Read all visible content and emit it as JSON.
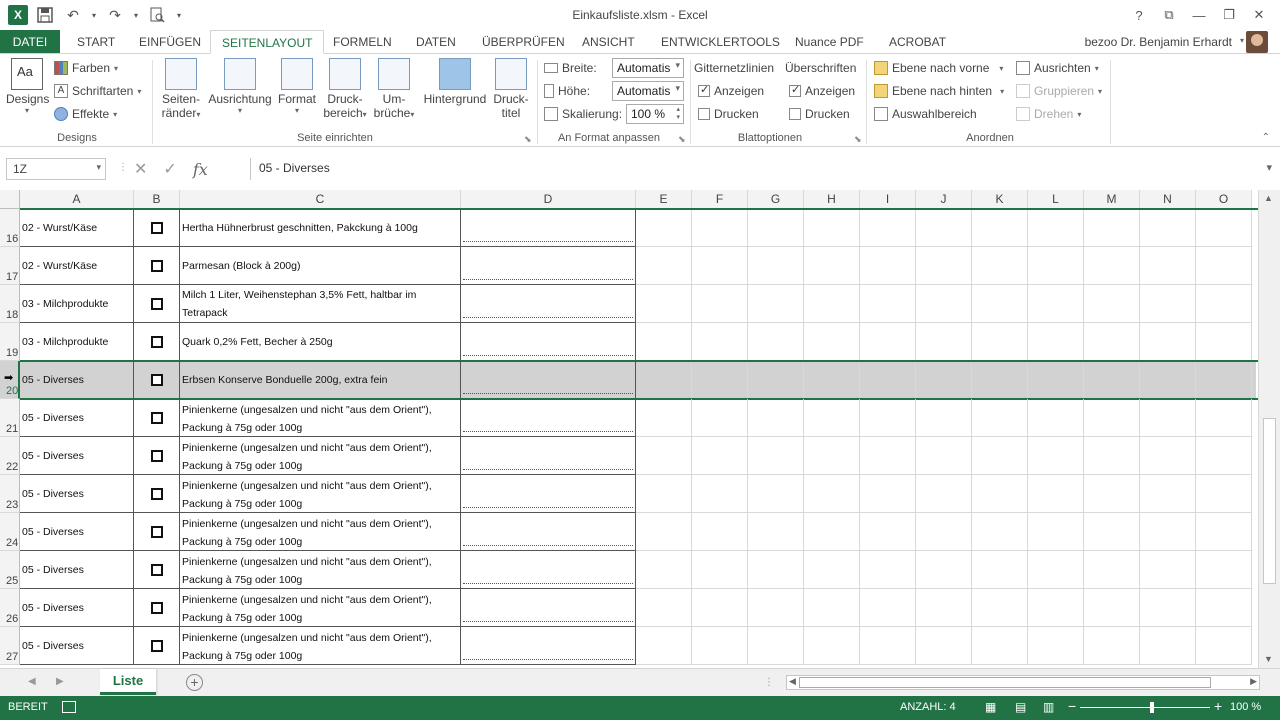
{
  "window": {
    "title": "Einkaufsliste.xlsm - Excel",
    "user": "bezoo Dr. Benjamin Erhardt",
    "help": "?",
    "ribbon_opts": "⧉",
    "minimize": "—",
    "restore": "❐",
    "close": "✕"
  },
  "qat": {
    "logo": "X"
  },
  "tabs": [
    {
      "label": "DATEI"
    },
    {
      "label": "START"
    },
    {
      "label": "EINFÜGEN"
    },
    {
      "label": "SEITENLAYOUT"
    },
    {
      "label": "FORMELN"
    },
    {
      "label": "DATEN"
    },
    {
      "label": "ÜBERPRÜFEN"
    },
    {
      "label": "ANSICHT"
    },
    {
      "label": "ENTWICKLERTOOLS"
    },
    {
      "label": "Nuance PDF"
    },
    {
      "label": "ACROBAT"
    }
  ],
  "ribbon": {
    "designs": {
      "label": "Designs",
      "farben": "Farben",
      "schriftarten": "Schriftarten",
      "effekte": "Effekte",
      "group": "Designs"
    },
    "seite": {
      "seitenraender": [
        "Seiten-",
        "ränder"
      ],
      "ausrichtung": "Ausrichtung",
      "format": "Format",
      "druckbereich": [
        "Druck-",
        "bereich"
      ],
      "umbrueche": [
        "Um-",
        "brüche"
      ],
      "hintergrund": "Hintergrund",
      "drucktitel": [
        "Druck-",
        "titel"
      ],
      "group": "Seite einrichten"
    },
    "anpassen": {
      "breite_label": "Breite:",
      "breite_value": "Automatis",
      "hoehe_label": "Höhe:",
      "hoehe_value": "Automatis",
      "skalierung_label": "Skalierung:",
      "skalierung_value": "100 %",
      "group": "An Format anpassen"
    },
    "blatt": {
      "gitternetz": "Gitternetzlinien",
      "ueberschriften": "Überschriften",
      "anzeigen": "Anzeigen",
      "drucken": "Drucken",
      "group": "Blattoptionen"
    },
    "anordnen": {
      "vorne": "Ebene nach vorne",
      "hinten": "Ebene nach hinten",
      "auswahl": "Auswahlbereich",
      "ausrichten": "Ausrichten",
      "gruppieren": "Gruppieren",
      "drehen": "Drehen",
      "group": "Anordnen"
    }
  },
  "formula_bar": {
    "namebox": "1Z",
    "content": "05 - Diverses",
    "fx": "fx"
  },
  "columns": [
    "A",
    "B",
    "C",
    "D",
    "E",
    "F",
    "G",
    "H",
    "I",
    "J",
    "K",
    "L",
    "M",
    "N",
    "O"
  ],
  "rows": [
    {
      "num": "16",
      "a": "02 - Wurst/Käse",
      "c": "Hertha Hühnerbrust geschnitten, Pakckung à 100g"
    },
    {
      "num": "17",
      "a": "02 - Wurst/Käse",
      "c": "Parmesan (Block à 200g)"
    },
    {
      "num": "18",
      "a": "03 - Milchprodukte",
      "c": "Milch 1 Liter, Weihenstephan 3,5% Fett, haltbar im Tetrapack"
    },
    {
      "num": "19",
      "a": "03 - Milchprodukte",
      "c": "Quark 0,2% Fett, Becher à 250g"
    },
    {
      "num": "20",
      "a": "05 - Diverses",
      "c": "Erbsen Konserve Bonduelle 200g, extra fein"
    },
    {
      "num": "21",
      "a": "05 - Diverses",
      "c": "Pinienkerne (ungesalzen und nicht \"aus dem Orient\"), Packung à 75g oder 100g"
    },
    {
      "num": "22",
      "a": "05 - Diverses",
      "c": "Pinienkerne (ungesalzen und nicht \"aus dem Orient\"), Packung à 75g oder 100g"
    },
    {
      "num": "23",
      "a": "05 - Diverses",
      "c": "Pinienkerne (ungesalzen und nicht \"aus dem Orient\"), Packung à 75g oder 100g"
    },
    {
      "num": "24",
      "a": "05 - Diverses",
      "c": "Pinienkerne (ungesalzen und nicht \"aus dem Orient\"), Packung à 75g oder 100g"
    },
    {
      "num": "25",
      "a": "05 - Diverses",
      "c": "Pinienkerne (ungesalzen und nicht \"aus dem Orient\"), Packung à 75g oder 100g"
    },
    {
      "num": "26",
      "a": "05 - Diverses",
      "c": "Pinienkerne (ungesalzen und nicht \"aus dem Orient\"), Packung à 75g oder 100g"
    },
    {
      "num": "27",
      "a": "05 - Diverses",
      "c": "Pinienkerne (ungesalzen und nicht \"aus dem Orient\"), Packung à 75g oder 100g"
    }
  ],
  "selected_row": "20",
  "sheet": {
    "name": "Liste",
    "add": "+"
  },
  "status": {
    "ready": "BEREIT",
    "count": "ANZAHL: 4",
    "zoom": "100 %",
    "zoom_minus": "−",
    "zoom_plus": "+"
  },
  "colors": {
    "accent": "#217346",
    "selection": "#d2d2d2"
  }
}
